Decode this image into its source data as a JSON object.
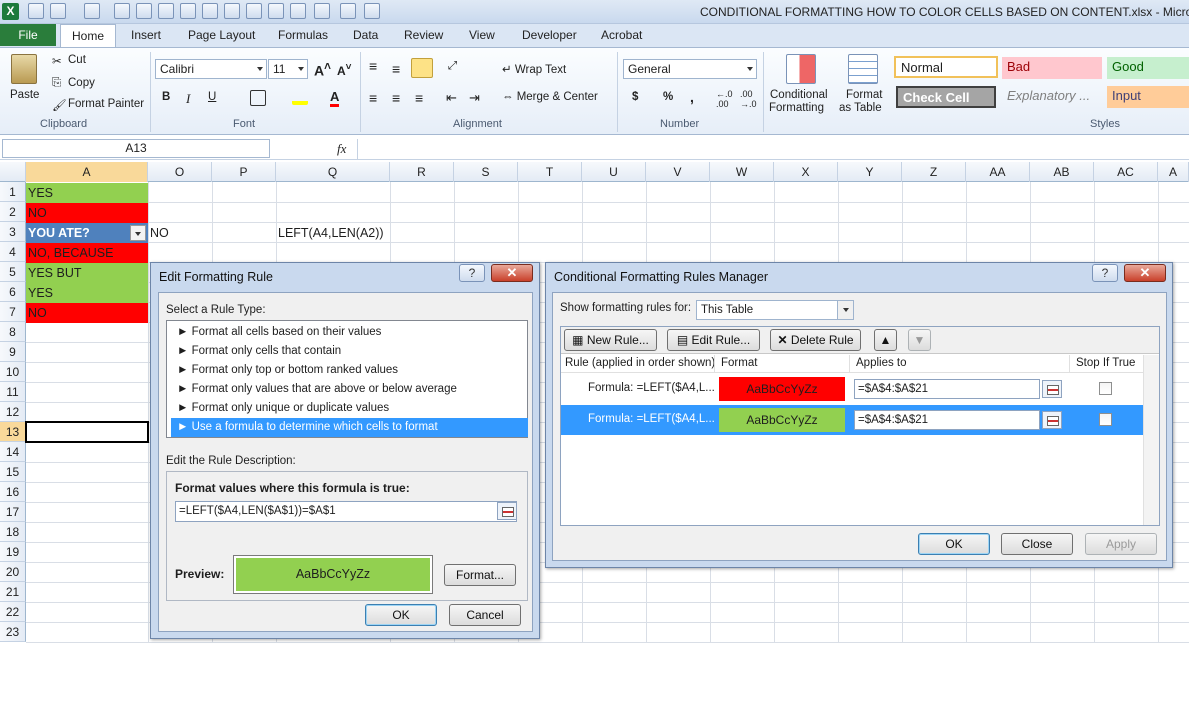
{
  "window": {
    "title": "CONDITIONAL FORMATTING HOW TO COLOR CELLS BASED ON CONTENT.xlsx - Microsoft"
  },
  "qat": {
    "logo": "X"
  },
  "tabs": [
    "File",
    "Home",
    "Insert",
    "Page Layout",
    "Formulas",
    "Data",
    "Review",
    "View",
    "Developer",
    "Acrobat"
  ],
  "ribbon": {
    "clipboard": {
      "paste": "Paste",
      "cut": "Cut",
      "copy": "Copy",
      "format_painter": "Format Painter",
      "label": "Clipboard"
    },
    "font": {
      "name": "Calibri",
      "size": "11",
      "label": "Font",
      "bold": "B",
      "italic": "I",
      "underline": "U"
    },
    "alignment": {
      "wrap": "Wrap Text",
      "merge": "Merge & Center",
      "label": "Alignment"
    },
    "number": {
      "format": "General",
      "currency": "$",
      "percent": "%",
      "comma": ",",
      "label": "Number"
    },
    "styles": {
      "cond_fmt_1": "Conditional",
      "cond_fmt_2": "Formatting",
      "fmt_table_1": "Format",
      "fmt_table_2": "as Table",
      "normal": "Normal",
      "bad": "Bad",
      "good": "Good",
      "check_cell": "Check Cell",
      "explanatory": "Explanatory ...",
      "input": "Input",
      "label": "Styles"
    }
  },
  "formula_bar": {
    "name_box": "A13",
    "fx": "fx",
    "value": ""
  },
  "columns": [
    "A",
    "O",
    "P",
    "Q",
    "R",
    "S",
    "T",
    "U",
    "V",
    "W",
    "X",
    "Y",
    "Z",
    "AA",
    "AB",
    "AC",
    "A"
  ],
  "rows": [
    "1",
    "2",
    "3",
    "4",
    "5",
    "6",
    "7",
    "8",
    "9",
    "10",
    "11",
    "12",
    "13",
    "14",
    "15",
    "16",
    "17",
    "18",
    "19",
    "20",
    "21",
    "22",
    "23"
  ],
  "cells": {
    "a1": "YES",
    "a2": "NO",
    "a3": "YOU ATE?",
    "a4": "NO, BECAUSE",
    "a5": "YES BUT",
    "a6": "YES",
    "a7": "NO",
    "o3": "NO",
    "q3": "LEFT(A4,LEN(A2))"
  },
  "colors": {
    "green": "#92d050",
    "red": "#ff0000",
    "header_blue": "#4f81bd",
    "selection": "#3399ff"
  },
  "edit_rule_dialog": {
    "title": "Edit Formatting Rule",
    "help": "?",
    "close": "✕",
    "select_label": "Select a Rule Type:",
    "rule_types": [
      "► Format all cells based on their values",
      "► Format only cells that contain",
      "► Format only top or bottom ranked values",
      "► Format only values that are above or below average",
      "► Format only unique or duplicate values",
      "► Use a formula to determine which cells to format"
    ],
    "edit_label": "Edit the Rule Description:",
    "formula_label": "Format values where this formula is true:",
    "formula": "=LEFT($A4,LEN($A$1))=$A$1",
    "preview_label": "Preview:",
    "preview_text": "AaBbCcYyZz",
    "format_btn": "Format...",
    "ok": "OK",
    "cancel": "Cancel"
  },
  "manager_dialog": {
    "title": "Conditional Formatting Rules Manager",
    "help": "?",
    "close": "✕",
    "show_label": "Show formatting rules for:",
    "show_value": "This Table",
    "new_rule": "New Rule...",
    "edit_rule": "Edit Rule...",
    "delete_rule": "Delete Rule",
    "headers": {
      "rule": "Rule (applied in order shown)",
      "format": "Format",
      "applies": "Applies to",
      "stop": "Stop If True"
    },
    "rules": [
      {
        "rule": "Formula: =LEFT($A4,L...",
        "preview": "AaBbCcYyZz",
        "applies": "=$A$4:$A$21"
      },
      {
        "rule": "Formula: =LEFT($A4,L...",
        "preview": "AaBbCcYyZz",
        "applies": "=$A$4:$A$21"
      }
    ],
    "ok": "OK",
    "close_btn": "Close",
    "apply": "Apply"
  }
}
